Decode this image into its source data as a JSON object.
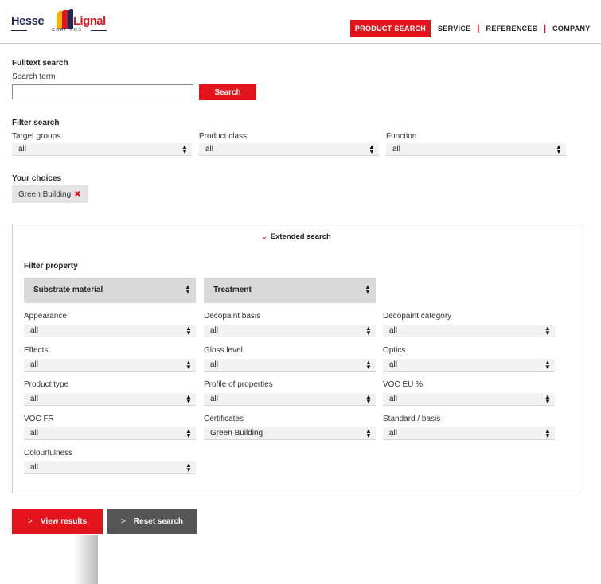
{
  "header": {
    "logo": {
      "word1": "Hesse",
      "word2": "Lignal",
      "sub": "COATINGS"
    },
    "nav": [
      {
        "label": "PRODUCT SEARCH",
        "active": true
      },
      {
        "label": "SERVICE"
      },
      {
        "label": "REFERENCES"
      },
      {
        "label": "COMPANY"
      }
    ],
    "separator": "|"
  },
  "fulltext": {
    "heading": "Fulltext search",
    "label": "Search term",
    "value": "",
    "button": "Search"
  },
  "filter": {
    "heading": "Filter search",
    "fields": [
      {
        "label": "Target groups",
        "value": "all"
      },
      {
        "label": "Product class",
        "value": "all"
      },
      {
        "label": "Function",
        "value": "all"
      }
    ]
  },
  "choices": {
    "heading": "Your choices",
    "chips": [
      {
        "label": "Green Building",
        "remove": "✖"
      }
    ]
  },
  "extended": {
    "toggle": "Extended search",
    "chevron": "⌄",
    "filter_property": "Filter property",
    "property_selects": [
      "Substrate material",
      "Treatment"
    ],
    "fields": [
      {
        "label": "Appearance",
        "value": "all"
      },
      {
        "label": "Decopaint basis",
        "value": "all"
      },
      {
        "label": "Decopaint category",
        "value": "all"
      },
      {
        "label": "Effects",
        "value": "all"
      },
      {
        "label": "Gloss level",
        "value": "all"
      },
      {
        "label": "Optics",
        "value": "all"
      },
      {
        "label": "Product type",
        "value": "all"
      },
      {
        "label": "Profile of properties",
        "value": "all"
      },
      {
        "label": "VOC EU %",
        "value": "all"
      },
      {
        "label": "VOC FR",
        "value": "all"
      },
      {
        "label": "Certificates",
        "value": "Green Building"
      },
      {
        "label": "Standard / basis",
        "value": "all"
      },
      {
        "label": "Colourfulness",
        "value": "all"
      }
    ]
  },
  "actions": {
    "view": "View results",
    "reset": "Reset search",
    "arrow": ">"
  },
  "colors": {
    "brand_red": "#e3131b",
    "navy": "#1e2a55",
    "dark_button": "#555555"
  }
}
